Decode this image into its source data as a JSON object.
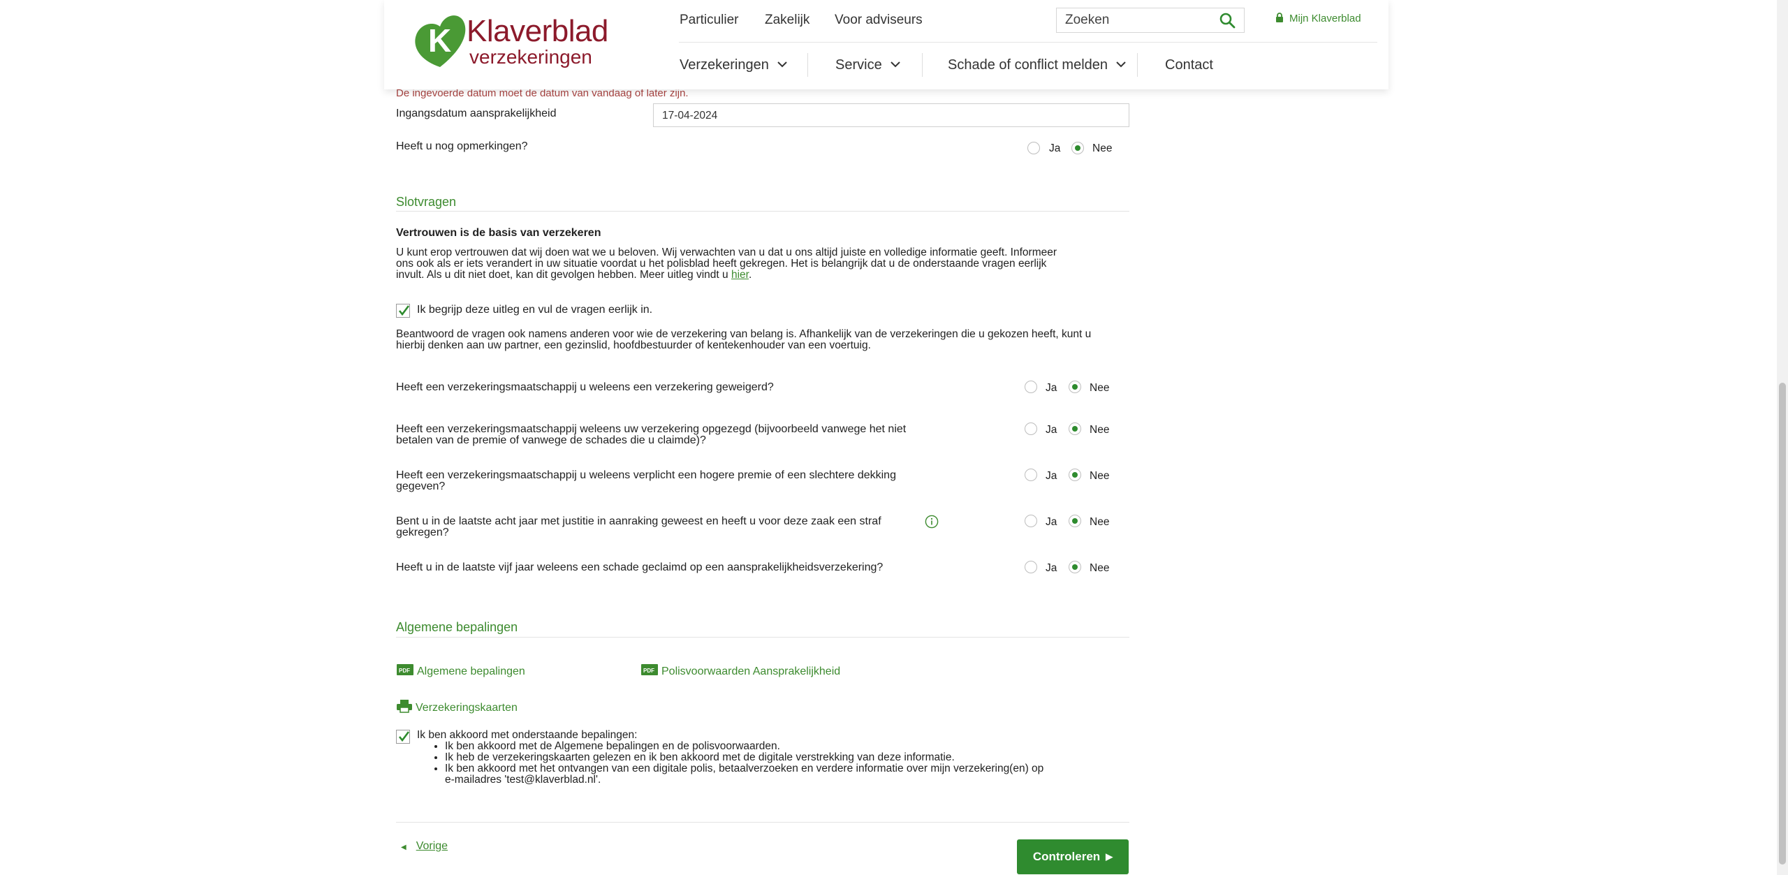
{
  "brand": {
    "logo_line1": "Klaverblad",
    "logo_line2": "verzekeringen",
    "green": "#3d8b2f",
    "red": "#8c1a2b"
  },
  "header": {
    "top_links": [
      "Particulier",
      "Zakelijk",
      "Voor adviseurs"
    ],
    "search_placeholder": "Zoeken",
    "account_label": "Mijn Klaverblad",
    "main_nav": [
      "Verzekeringen",
      "Service",
      "Schade of conflict melden",
      "Contact"
    ]
  },
  "form": {
    "date_error": "De ingevoerde datum moet de datum van vandaag of later zijn.",
    "start_date_label": "Ingangsdatum aansprakelijkheid",
    "start_date_value": "17-04-2024",
    "remarks_question": "Heeft u nog opmerkingen?",
    "yes": "Ja",
    "no": "Nee"
  },
  "slotvragen": {
    "title": "Slotvragen",
    "subtitle": "Vertrouwen is de basis van verzekeren",
    "paragraph_line1": "U kunt erop vertrouwen dat wij doen wat we u beloven. Wij verwachten van u dat u ons altijd juiste en volledige informatie geeft. Informeer",
    "paragraph_line2": "ons ook als er iets verandert in uw situatie voordat u het polisblad heeft gekregen. Het is belangrijk dat u de onderstaande vragen eerlijk",
    "paragraph_line3": "invult. Als u dit niet doet, kan dit gevolgen hebben. Meer uitleg vindt u",
    "here_link": "hier",
    "understand_label": "Ik begrijp deze uitleg en vul de vragen eerlijk in.",
    "others_line1": "Beantwoord de vragen ook namens anderen voor wie de verzekering van belang is. Afhankelijk van de verzekeringen die u gekozen heeft, kunt u",
    "others_line2": "hierbij denken aan uw partner, een gezinslid, hoofdbestuurder of kentekenhouder van een voertuig.",
    "questions": [
      {
        "line1": "Heeft een verzekeringsmaatschappij u weleens een verzekering geweigerd?",
        "line2": ""
      },
      {
        "line1": "Heeft een verzekeringsmaatschappij weleens uw verzekering opgezegd (bijvoorbeeld vanwege het niet",
        "line2": "betalen van de premie of vanwege de schades die u claimde)?"
      },
      {
        "line1": "Heeft een verzekeringsmaatschappij u weleens verplicht een hogere premie of een slechtere dekking",
        "line2": "gegeven?"
      },
      {
        "line1": "Bent u in de laatste acht jaar met justitie in aanraking geweest en heeft u voor deze zaak een straf",
        "line2": "gekregen?"
      },
      {
        "line1": "Heeft u in de laatste vijf jaar weleens een schade geclaimd op een aansprakelijkheidsverzekering?",
        "line2": ""
      }
    ]
  },
  "algemeen": {
    "title": "Algemene bepalingen",
    "doc1": "Algemene bepalingen",
    "doc2": "Polisvoorwaarden Aansprakelijkheid",
    "print_label": "Verzekeringskaarten",
    "agree_label": "Ik ben akkoord met onderstaande bepalingen:",
    "agree_items": [
      "Ik ben akkoord met de Algemene bepalingen en de polisvoorwaarden.",
      "Ik heb de verzekeringskaarten gelezen en ik ben akkoord met de digitale verstrekking van deze informatie.",
      "Ik ben akkoord met het ontvangen van een digitale polis, betaalverzoeken en verdere informatie over mijn verzekering(en) op"
    ],
    "agree_item3_line2": "e-mailadres 'test@klaverblad.nl'."
  },
  "footer_nav": {
    "prev": "Vorige",
    "next": "Controleren"
  }
}
